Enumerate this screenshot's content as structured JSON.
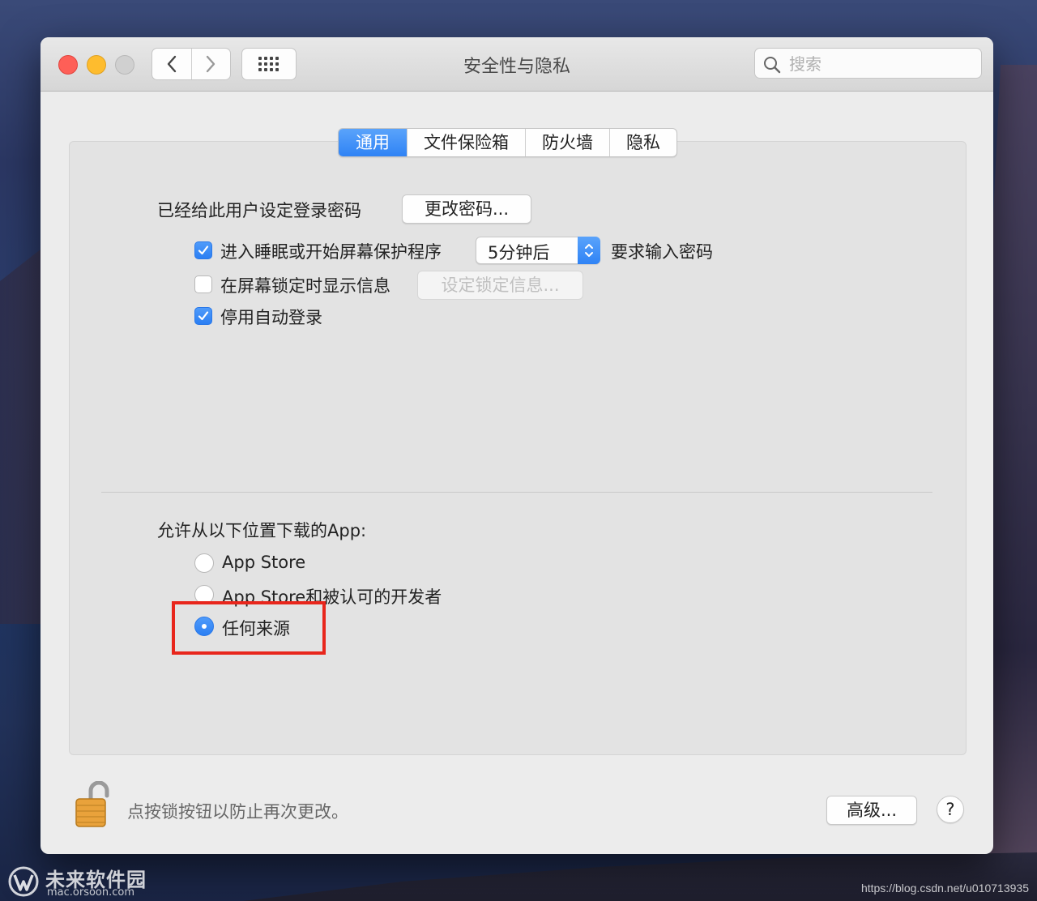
{
  "window": {
    "title": "安全性与隐私",
    "search": {
      "placeholder": "搜索",
      "value": ""
    }
  },
  "tabs": [
    {
      "label": "通用",
      "active": true
    },
    {
      "label": "文件保险箱",
      "active": false
    },
    {
      "label": "防火墙",
      "active": false
    },
    {
      "label": "隐私",
      "active": false
    }
  ],
  "general": {
    "password_set_text": "已经给此用户设定登录密码",
    "change_password_button": "更改密码...",
    "require_password": {
      "checked": true,
      "label": "进入睡眠或开始屏幕保护程序",
      "delay_value": "5分钟后",
      "suffix": "要求输入密码"
    },
    "show_message": {
      "checked": false,
      "label": "在屏幕锁定时显示信息",
      "button": "设定锁定信息..."
    },
    "disable_auto_login": {
      "checked": true,
      "label": "停用自动登录"
    }
  },
  "downloads": {
    "heading": "允许从以下位置下载的App:",
    "options": [
      {
        "label": "App Store",
        "selected": false
      },
      {
        "label": "App Store和被认可的开发者",
        "selected": false
      },
      {
        "label": "任何来源",
        "selected": true
      }
    ]
  },
  "footer": {
    "lock_text": "点按锁按钮以防止再次更改。",
    "advanced_button": "高级...",
    "help_button": "?"
  },
  "watermarks": {
    "brand_name": "未来软件园",
    "brand_url": "mac.orsoon.com",
    "csdn_url": "https://blog.csdn.net/u010713935"
  },
  "colors": {
    "accent": "#2f83f5",
    "highlight_box": "#e8261c"
  }
}
